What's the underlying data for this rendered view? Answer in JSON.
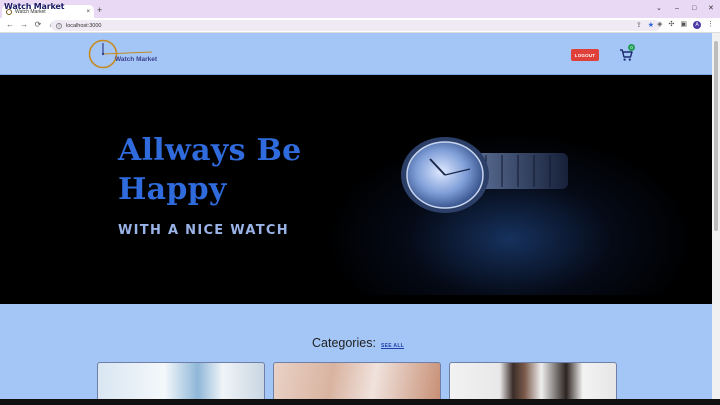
{
  "browser": {
    "overlay_caption": "Watch Market",
    "tab": {
      "title": "Watch Market",
      "close": "×"
    },
    "new_tab": "+",
    "window_controls": {
      "minimize": "⌄",
      "restore": "–",
      "maximize": "□",
      "close": "✕"
    },
    "toolbar": {
      "back": "←",
      "forward": "→",
      "reload": "⟳",
      "home": "⌂",
      "url": "localhost:3000",
      "profile_initial": "A"
    }
  },
  "site": {
    "logo_text": "Watch Market",
    "logout_label": "LOGOUT",
    "cart_count": "0"
  },
  "hero": {
    "title_line1": "Allways Be",
    "title_line2": "Happy",
    "subtitle": "WITH A NICE WATCH"
  },
  "categories": {
    "title": "Categories:",
    "see_all": "SEE ALL"
  },
  "colors": {
    "page_bg": "#a3c6f7",
    "hero_bg": "#000000",
    "accent_title": "#2f6bdc",
    "logout_bg": "#e0403a",
    "cart_badge": "#1f9d55"
  }
}
